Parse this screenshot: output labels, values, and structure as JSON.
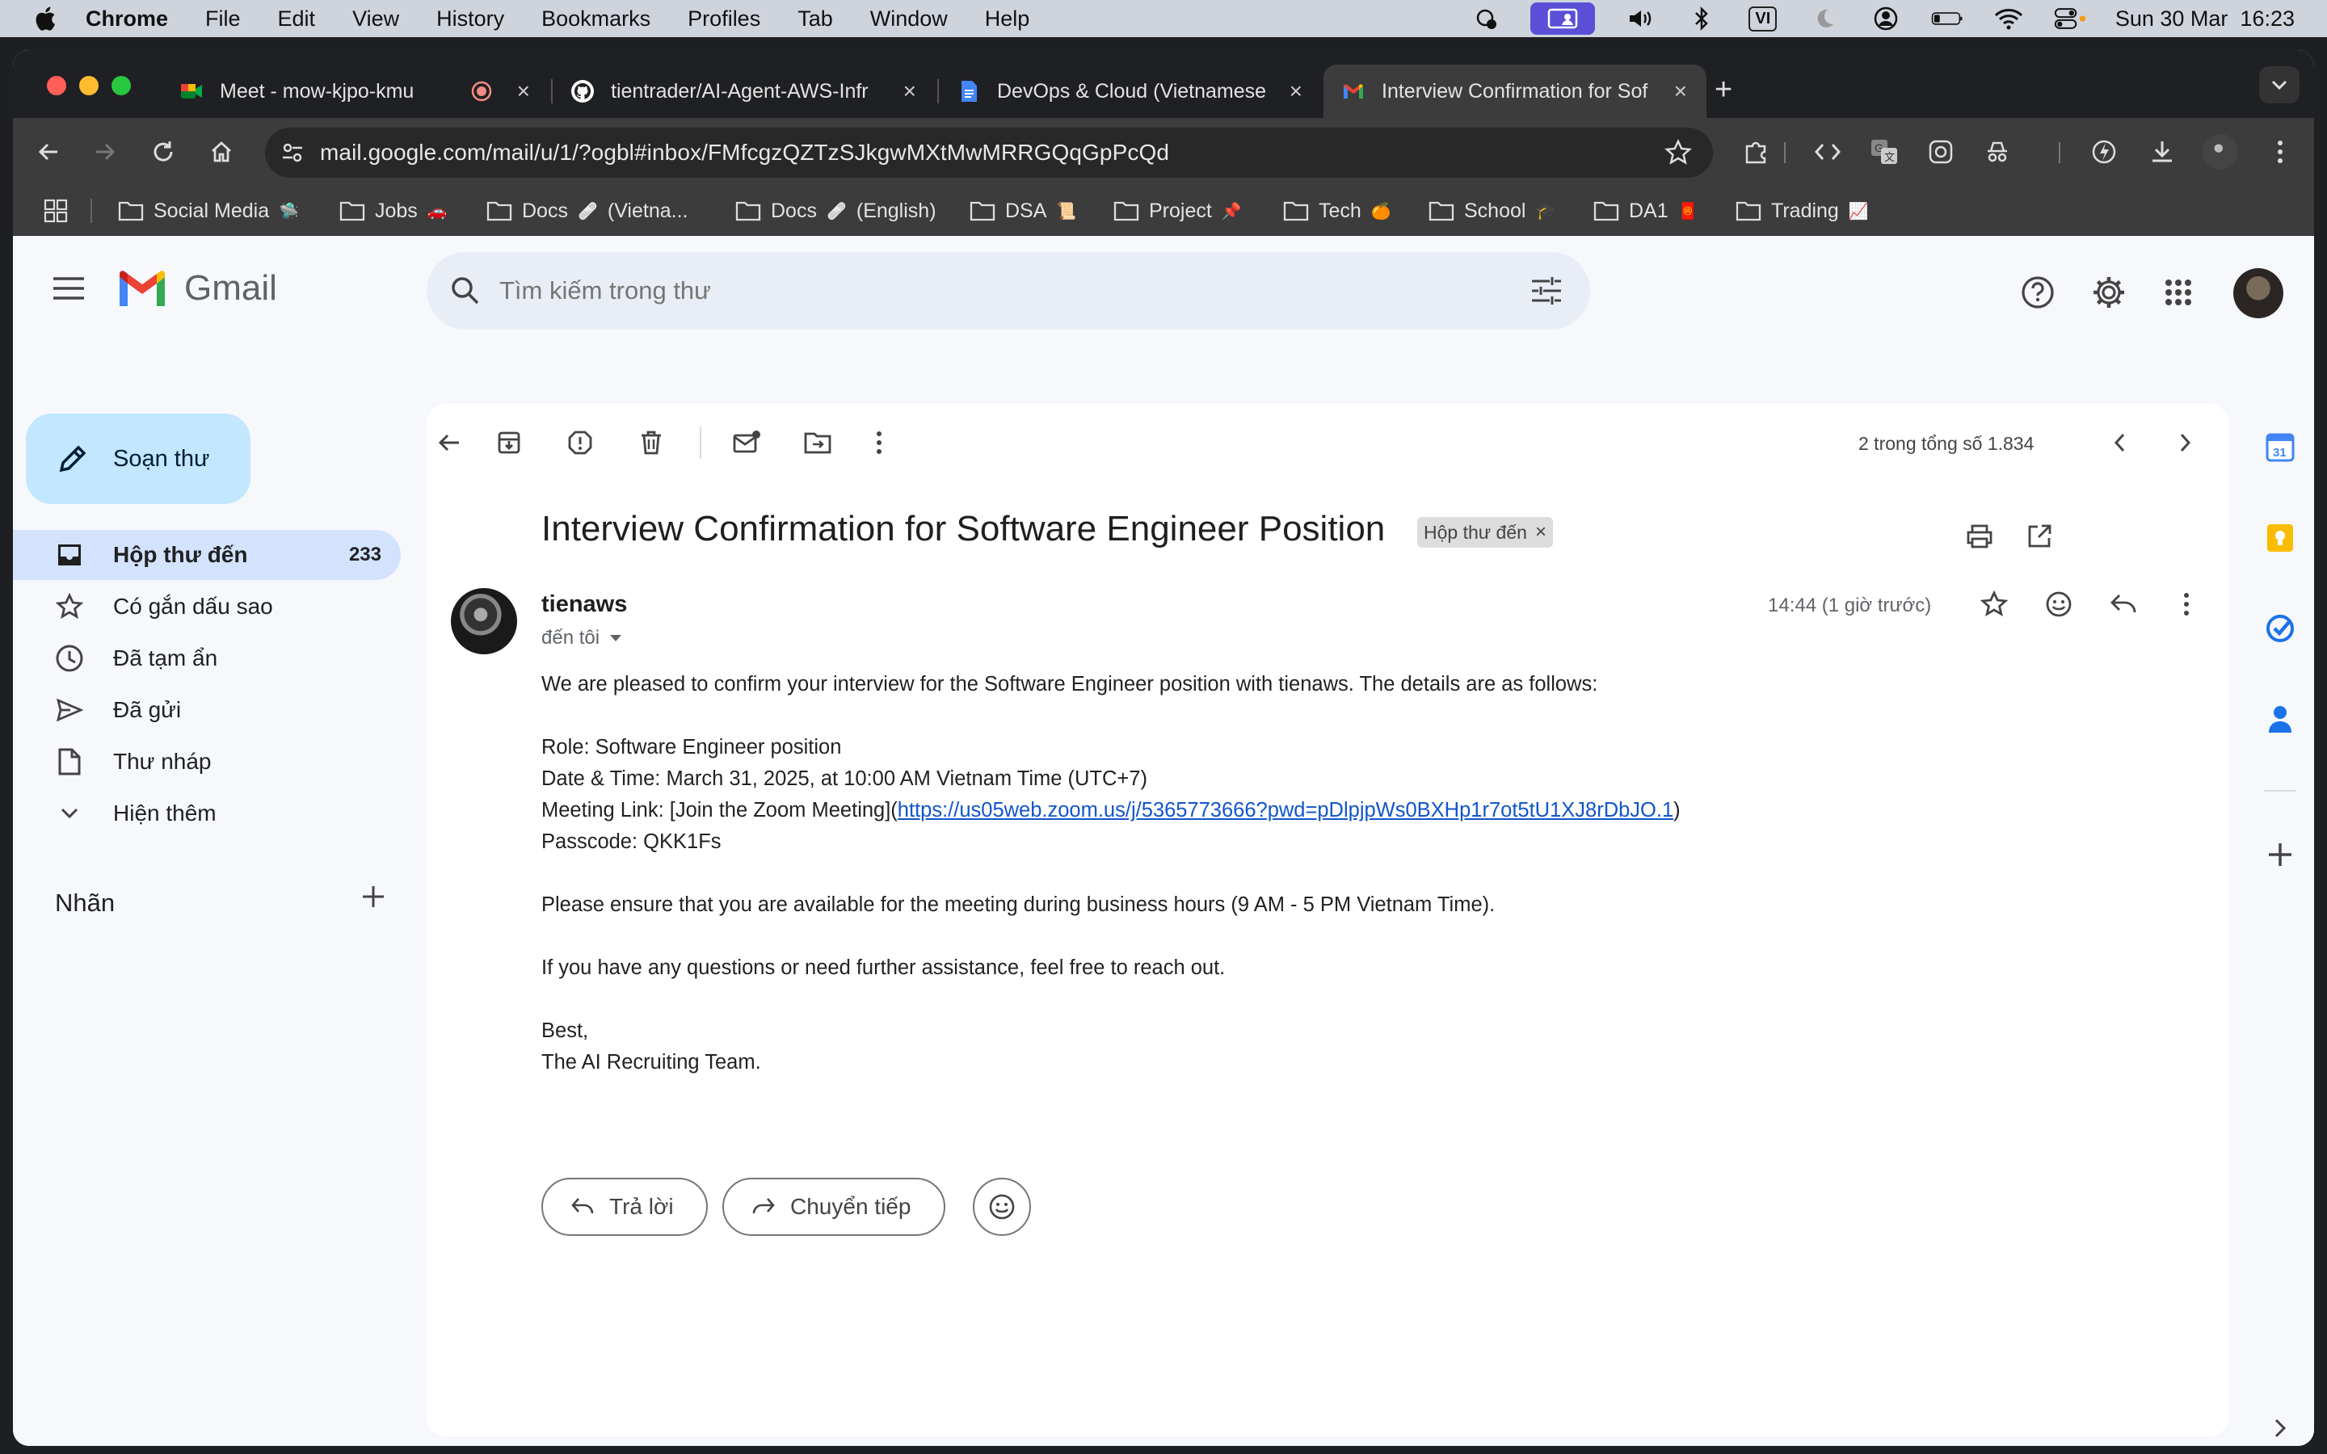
{
  "menubar": {
    "app": "Chrome",
    "items": [
      "File",
      "Edit",
      "View",
      "History",
      "Bookmarks",
      "Profiles",
      "Tab",
      "Window",
      "Help"
    ],
    "input_source": "VI",
    "datetime": "Sun 30 Mar  16:23"
  },
  "tabs": [
    {
      "title": "Meet - mow-kjpo-kmu",
      "icon": "google-meet-icon"
    },
    {
      "title": "tientrader/AI-Agent-AWS-Infr",
      "icon": "github-icon"
    },
    {
      "title": "DevOps & Cloud (Vietnamese",
      "icon": "google-docs-icon"
    },
    {
      "title": "Interview Confirmation for Sof",
      "icon": "gmail-icon",
      "active": true
    }
  ],
  "omnibox": {
    "url": "mail.google.com/mail/u/1/?ogbl#inbox/FMfcgzQZTzSJkgwMXtMwMRRGQqGpPcQd"
  },
  "bookmarks": [
    {
      "label": "Social Media",
      "emoji": "🛸"
    },
    {
      "label": "Jobs",
      "emoji": "🚗"
    },
    {
      "label": "Docs",
      "emoji": "🩹",
      "suffix": "(Vietna..."
    },
    {
      "label": "Docs",
      "emoji": "🩹",
      "suffix": "(English)"
    },
    {
      "label": "DSA",
      "emoji": "📜"
    },
    {
      "label": "Project",
      "emoji": "📌"
    },
    {
      "label": "Tech",
      "emoji": "🍊"
    },
    {
      "label": "School",
      "emoji": "🎓"
    },
    {
      "label": "DA1",
      "emoji": "🧧"
    },
    {
      "label": "Trading",
      "emoji": "📈"
    }
  ],
  "gmail": {
    "brand": "Gmail",
    "search_placeholder": "Tìm kiếm trong thư",
    "compose": "Soạn thư",
    "nav": [
      {
        "label": "Hộp thư đến",
        "count": "233",
        "icon": "inbox-icon"
      },
      {
        "label": "Có gắn dấu sao",
        "icon": "star-icon"
      },
      {
        "label": "Đã tạm ẩn",
        "icon": "clock-icon"
      },
      {
        "label": "Đã gửi",
        "icon": "send-icon"
      },
      {
        "label": "Thư nháp",
        "icon": "draft-icon"
      },
      {
        "label": "Hiện thêm",
        "icon": "chevron-down-icon"
      }
    ],
    "labels_heading": "Nhãn",
    "pager": "2 trong tổng số 1.834",
    "email": {
      "subject": "Interview Confirmation for Software Engineer Position",
      "label_chip": "Hộp thư đến",
      "sender": "tienaws",
      "to": "đến tôi",
      "time": "14:44 (1 giờ trước)",
      "intro": "We are pleased to confirm your interview for the Software Engineer position with tienaws. The details are as follows:",
      "role": "Role: Software Engineer position",
      "datetime": "Date & Time: March 31, 2025, at 10:00 AM Vietnam Time (UTC+7)",
      "meeting_prefix": "Meeting Link: [Join the Zoom Meeting](",
      "meeting_url": "https://us05web.zoom.us/j/5365773666?pwd=pDlpjpWs0BXHp1r7ot5tU1XJ8rDbJO.1",
      "meeting_suffix": ")",
      "passcode": "Passcode: QKK1Fs",
      "availability": "Please ensure that you are available for the meeting during business hours (9 AM - 5 PM Vietnam Time).",
      "questions": "If you have any questions or need further assistance, feel free to reach out.",
      "signoff": "Best,",
      "signature": "The AI Recruiting Team."
    },
    "reply_label": "Trả lời",
    "forward_label": "Chuyển tiếp",
    "colors": {
      "accent": "#0b57d0",
      "nav_active": "#d3e3fd",
      "compose": "#c2e7ff"
    }
  }
}
